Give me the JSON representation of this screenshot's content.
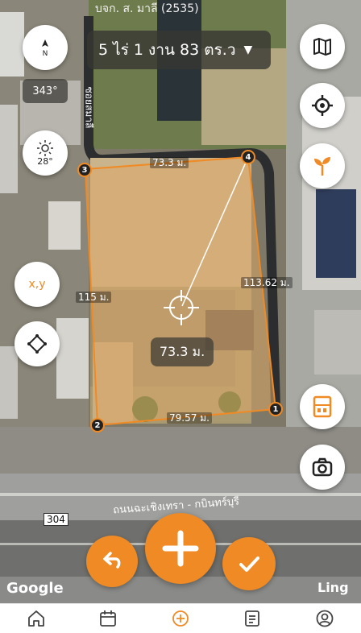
{
  "area_selector": {
    "label": "5 ไร่ 1 งาน 83 ตร.ว"
  },
  "compass": {
    "heading": "343°"
  },
  "weather": {
    "temperature": "28°"
  },
  "tools": {
    "coordinate_label": "x,y"
  },
  "plot": {
    "edges": {
      "top": "73.3 ม.",
      "right": "113.62 ม.",
      "bottom": "79.57 ม.",
      "left": "115 ม."
    },
    "vertices": [
      "1",
      "2",
      "3",
      "4"
    ],
    "center_measurement": "73.3 ม."
  },
  "map_labels": {
    "top_cut": "บจก. ส. มาลี (2535)",
    "soi": "ซอยสมาลี",
    "highway": "ถนนฉะเชิงเทรา - กบินทร์บุรี",
    "route_shield": "304",
    "google": "Google",
    "tag_right": "Ling"
  },
  "bottom_nav": [
    "home-icon",
    "calendar-icon",
    "add-plot-icon",
    "notes-icon",
    "profile-icon"
  ],
  "colors": {
    "accent": "#f08a24",
    "plot_fill": "#d9a366"
  }
}
